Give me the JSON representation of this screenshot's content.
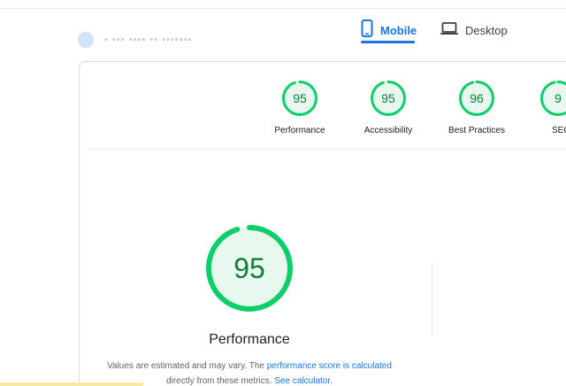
{
  "tabs": [
    {
      "label": "Mobile",
      "icon": "smartphone-icon",
      "selected": true
    },
    {
      "label": "Desktop",
      "icon": "laptop-icon",
      "selected": false
    }
  ],
  "categories": [
    {
      "label": "Performance",
      "score": "95"
    },
    {
      "label": "Accessibility",
      "score": "95"
    },
    {
      "label": "Best Practices",
      "score": "96"
    },
    {
      "label": "SEO",
      "score": "9"
    }
  ],
  "performance": {
    "score": "95",
    "title": "Performance",
    "desc_prefix": "Values are estimated and may vary. The ",
    "desc_link1": "performance score is calculated",
    "desc_middle": " directly from these metrics. ",
    "desc_link2": "See calculator",
    "desc_suffix": "."
  },
  "colors": {
    "accent": "#1a73e8",
    "pass": "#0cce6b",
    "pass_fill": "#e8f8ee",
    "pass_text": "#0a7f3a"
  }
}
